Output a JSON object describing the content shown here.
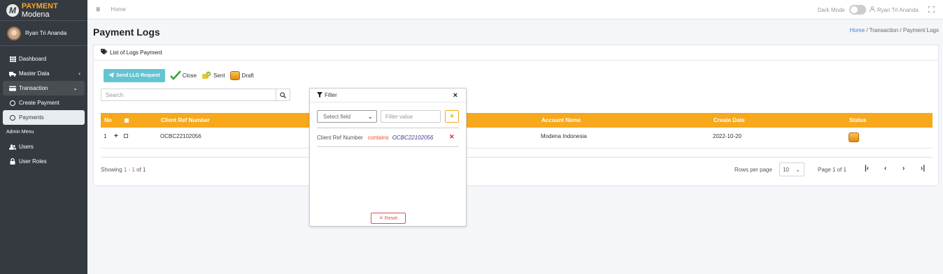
{
  "brand": {
    "name_bold": "PAYMENT",
    "name_rest": "Modena",
    "logo_letter": "M"
  },
  "sidebar": {
    "user_name": "Ryan Tri Ananda",
    "items": [
      {
        "label": "Dashboard",
        "icon": "table-icon"
      },
      {
        "label": "Master Data",
        "icon": "truck-icon"
      },
      {
        "label": "Transaction",
        "icon": "credit-card-icon"
      },
      {
        "label": "Create Payment",
        "icon": "circle-icon"
      },
      {
        "label": "Payments",
        "icon": "circle-icon"
      }
    ],
    "header": "Admin Menu",
    "admin_items": [
      {
        "label": "Users",
        "icon": "users-icon"
      },
      {
        "label": "User Roles",
        "icon": "lock-icon"
      }
    ]
  },
  "topbar": {
    "home": "Home",
    "dark_mode": "Dark Mode",
    "user": "Ryan Tri Ananda"
  },
  "page": {
    "title": "Payment Logs",
    "breadcrumb": {
      "home": "Home",
      "sep": "/",
      "transaction": "Transaction",
      "current": "Payment Logs"
    }
  },
  "card": {
    "title": "List of Logs Payment",
    "toolbar": {
      "send": "Send LLG Request",
      "close": "Close",
      "sent": "Sent",
      "draft": "Draft"
    },
    "search_placeholder": "Search",
    "table": {
      "headers": [
        "No",
        "Client Ref Number",
        "Account Name",
        "Create Date",
        "Status"
      ],
      "rows": [
        {
          "no": "1",
          "client_ref": "OCBC22102056",
          "account_name": "Modena Indonesia",
          "create_date": "2022-10-20",
          "status": "Draft"
        }
      ]
    },
    "footer": {
      "showing_prefix": "Showing ",
      "showing_range": "1 - 1",
      "showing_suffix": " of 1",
      "rows_per_page": "Rows per page",
      "rows_value": "10",
      "page_info": "Page 1 of 1"
    }
  },
  "filter": {
    "title": "Filter",
    "select_placeholder": "Select field",
    "value_placeholder": "Filter value",
    "add": "+",
    "condition": {
      "field": "Client Ref Number",
      "op": "contains",
      "value": "OCBC22102056"
    },
    "reset": "Reset"
  },
  "colors": {
    "accent": "#f7a81b",
    "sidebar": "#343a40",
    "info": "#64c4d2",
    "danger": "#d9534f"
  }
}
